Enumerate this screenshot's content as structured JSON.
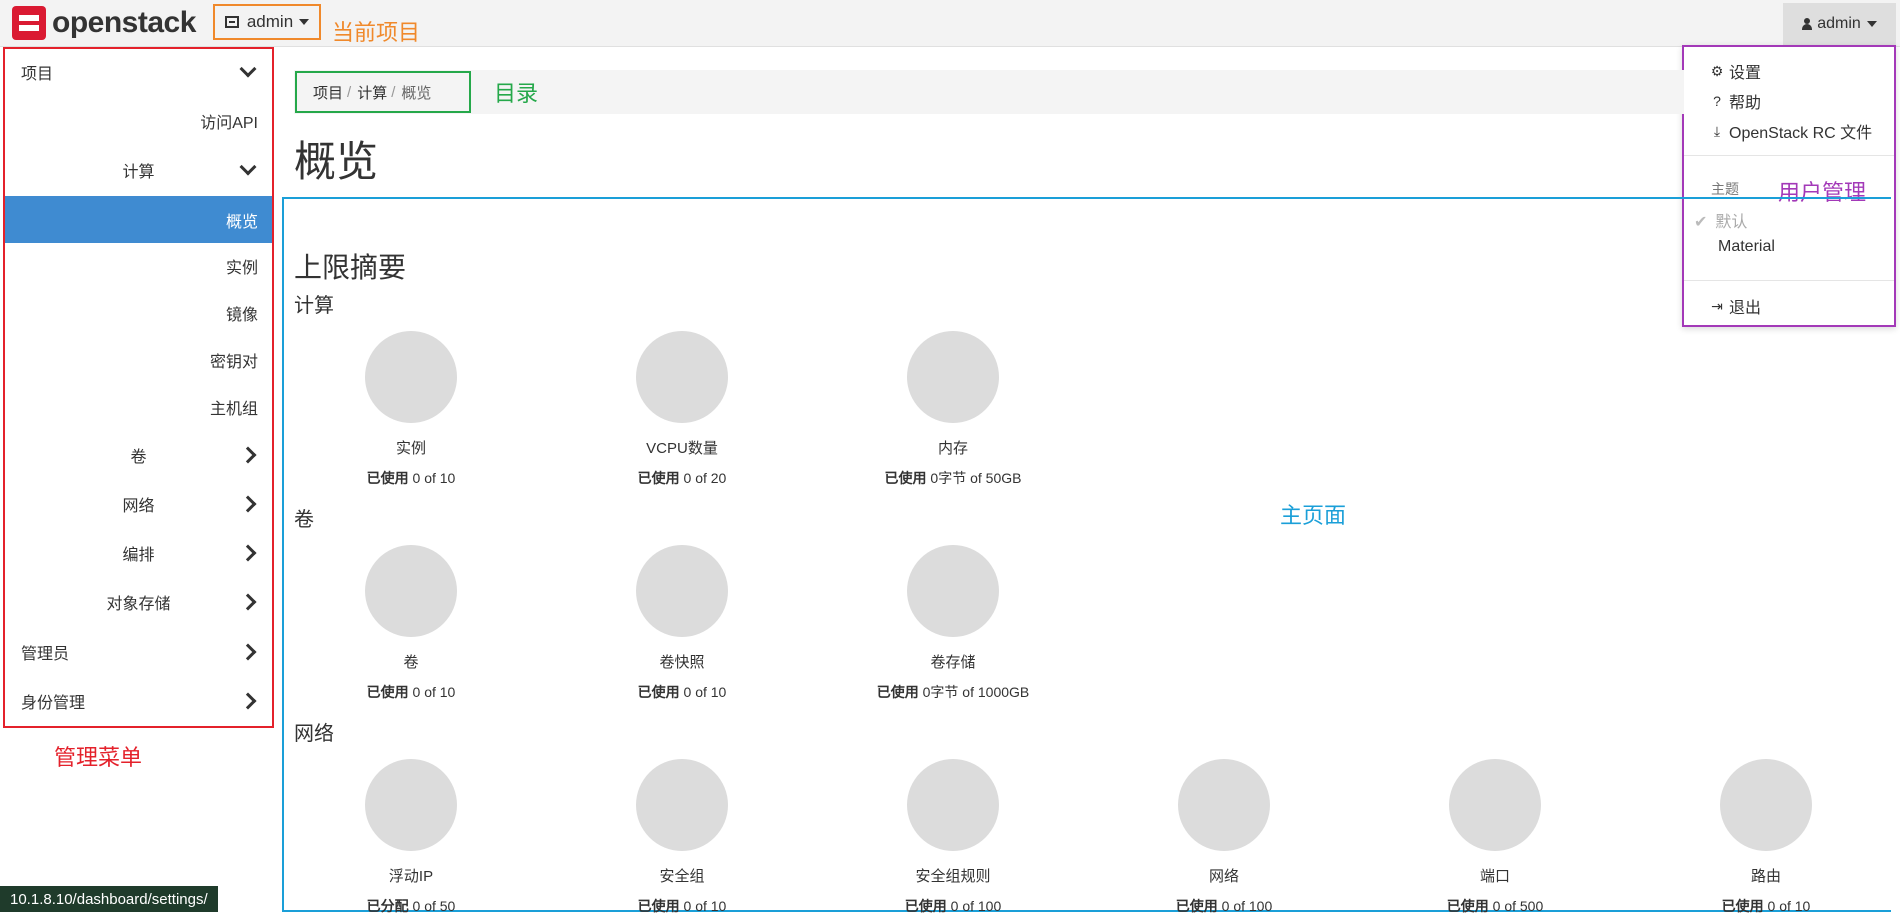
{
  "brand": {
    "name": "openstack"
  },
  "topbar": {
    "project_label": "admin",
    "user_label": "admin"
  },
  "annotations": {
    "current_project": "当前项目",
    "directory": "目录",
    "main_page": "主页面",
    "admin_menu": "管理菜单",
    "user_management": "用户管理"
  },
  "user_menu": {
    "settings": "设置",
    "help": "帮助",
    "rc_file": "OpenStack RC 文件",
    "theme_header": "主题",
    "theme_default": "默认",
    "theme_material": "Material",
    "logout": "退出"
  },
  "sidebar": {
    "project": "项目",
    "access_api": "访问API",
    "compute": "计算",
    "overview": "概览",
    "instances": "实例",
    "images": "镜像",
    "keypairs": "密钥对",
    "server_groups": "主机组",
    "volumes": "卷",
    "network": "网络",
    "orchestration": "编排",
    "object_store": "对象存储",
    "admin": "管理员",
    "identity": "身份管理"
  },
  "breadcrumb": {
    "project": "项目",
    "compute": "计算",
    "current": "概览"
  },
  "page": {
    "title": "概览",
    "section_title": "上限摘要"
  },
  "groups": {
    "compute": {
      "title": "计算",
      "charts": [
        {
          "label": "实例",
          "usage_prefix": "已使用",
          "usage": "0 of 10"
        },
        {
          "label": "VCPU数量",
          "usage_prefix": "已使用",
          "usage": "0 of 20"
        },
        {
          "label": "内存",
          "usage_prefix": "已使用",
          "usage": "0字节 of 50GB"
        }
      ]
    },
    "volume": {
      "title": "卷",
      "charts": [
        {
          "label": "卷",
          "usage_prefix": "已使用",
          "usage": "0 of 10"
        },
        {
          "label": "卷快照",
          "usage_prefix": "已使用",
          "usage": "0 of 10"
        },
        {
          "label": "卷存储",
          "usage_prefix": "已使用",
          "usage": "0字节 of 1000GB"
        }
      ]
    },
    "network": {
      "title": "网络",
      "charts": [
        {
          "label": "浮动IP",
          "usage_prefix": "已分配",
          "usage": "0 of 50"
        },
        {
          "label": "安全组",
          "usage_prefix": "已使用",
          "usage": "0 of 10"
        },
        {
          "label": "安全组规则",
          "usage_prefix": "已使用",
          "usage": "0 of 100"
        },
        {
          "label": "网络",
          "usage_prefix": "已使用",
          "usage": "0 of 100"
        },
        {
          "label": "端口",
          "usage_prefix": "已使用",
          "usage": "0 of 500"
        },
        {
          "label": "路由",
          "usage_prefix": "已使用",
          "usage": "0 of 10"
        }
      ]
    }
  },
  "status_bar": {
    "url": "10.1.8.10/dashboard/settings/"
  },
  "colors": {
    "brand_red": "#da1a32",
    "active_nav": "#3f8bd1",
    "annotation_orange": "#f0892b",
    "annotation_green": "#25a84a",
    "annotation_blue": "#1a9fd8",
    "annotation_red": "#e4212b",
    "annotation_purple": "#a339b8"
  }
}
